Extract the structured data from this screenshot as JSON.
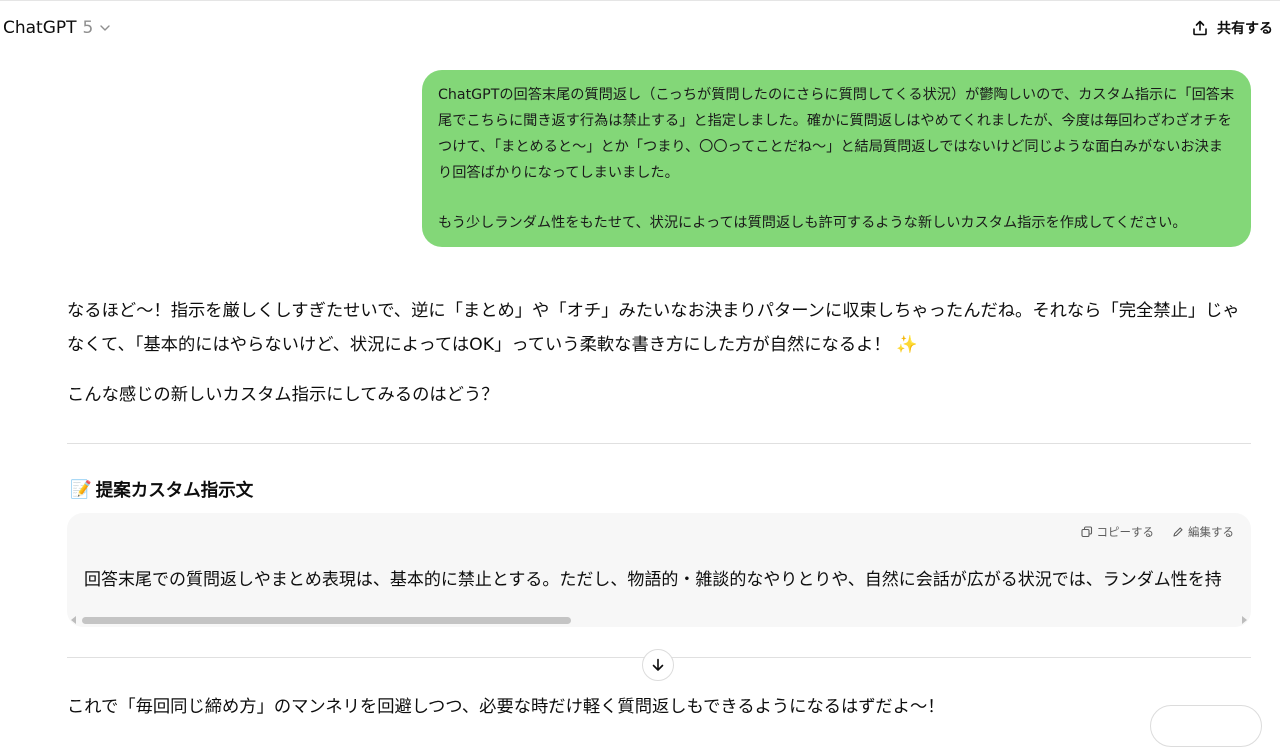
{
  "header": {
    "model_name": "ChatGPT",
    "model_version": "5",
    "share_label": "共有する"
  },
  "user_message": {
    "paragraphs": [
      "ChatGPTの回答末尾の質問返し（こっちが質問したのにさらに質問してくる状況）が鬱陶しいので、カスタム指示に「回答末尾でこちらに聞き返す行為は禁止する」と指定しました。確かに質問返しはやめてくれましたが、今度は毎回わざわざオチをつけて、「まとめると〜」とか「つまり、〇〇ってことだね〜」と結局質問返しではないけど同じような面白みがないお決まり回答ばかりになってしまいました。",
      "もう少しランダム性をもたせて、状況によっては質問返しも許可するような新しいカスタム指示を作成してください。"
    ]
  },
  "assistant_message": {
    "para1": "なるほど〜！指示を厳しくしすぎたせいで、逆に「まとめ」や「オチ」みたいなお決まりパターンに収束しちゃったんだね。それなら「完全禁止」じゃなくて、「基本的にはやらないけど、状況によってはOK」っていう柔軟な書き方にした方が自然になるよ！",
    "para1_emoji": "✨",
    "para2": "こんな感じの新しいカスタム指示にしてみるのはどう？",
    "section_emoji": "📝",
    "section_title": "提案カスタム指示文",
    "code_block": {
      "copy_label": "コピーする",
      "edit_label": "編集する",
      "text": "回答末尾での質問返しやまとめ表現は、基本的に禁止とする。ただし、物語的・雑談的なやりとりや、自然に会話が広がる状況では、ランダム性を持"
    },
    "para3": "これで「毎回同じ締め方」のマンネリを回避しつつ、必要な時だけ軽く質問返しもできるようになるはずだよ〜！"
  },
  "colors": {
    "user_bubble": "#83d778",
    "code_bg": "#f7f7f7"
  },
  "icons": {
    "model_chevron": "chevron-down-icon",
    "share": "share-upload-icon",
    "copy": "copy-icon",
    "edit": "pencil-icon",
    "scroll_down": "arrow-down-icon"
  }
}
